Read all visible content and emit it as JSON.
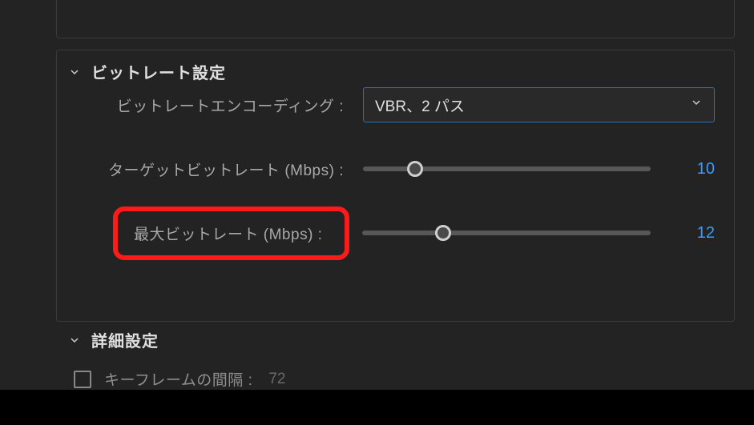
{
  "sections": {
    "bitrate": {
      "title": "ビットレート設定",
      "encoding": {
        "label": "ビットレートエンコーディング :",
        "value": "VBR、2 パス"
      },
      "target": {
        "label": "ターゲットビットレート (Mbps) :",
        "value": "10",
        "thumb_pct": 18
      },
      "max": {
        "label": "最大ビットレート (Mbps) :",
        "value": "12",
        "thumb_pct": 28
      }
    },
    "advanced": {
      "title": "詳細設定",
      "keyframe": {
        "label": "キーフレームの間隔 :",
        "value": "72"
      }
    }
  }
}
